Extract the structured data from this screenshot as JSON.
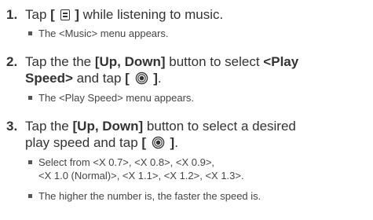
{
  "steps": [
    {
      "number": "1.",
      "pre": "Tap ",
      "bracket_open": "[ ",
      "icon": "menu-icon",
      "bracket_close": " ]",
      "post": " while listening to music.",
      "notes": [
        "The <Music> menu appears."
      ]
    },
    {
      "number": "2.",
      "line1_pre": "Tap the the ",
      "line1_bold": "[Up, Down]",
      "line1_mid": " button to select ",
      "line1_bold2": "<Play",
      "line2_bold": "Speed>",
      "line2_mid": " and tap ",
      "bracket_open": "[ ",
      "icon": "select-icon",
      "bracket_close": " ]",
      "line2_end": ".",
      "notes": [
        "The <Play Speed> menu appears."
      ]
    },
    {
      "number": "3.",
      "line1_pre": "Tap the ",
      "line1_bold": "[Up, Down]",
      "line1_post": " button to select a desired",
      "line2_pre": "play speed and tap ",
      "bracket_open": "[ ",
      "icon": "select-icon",
      "bracket_close": " ]",
      "line2_end": ".",
      "notes": [
        {
          "line1": "Select from <X 0.7>, <X 0.8>, <X 0.9>,",
          "line2": "<X 1.0 (Normal)>, <X 1.1>, <X 1.2>, <X 1.3>."
        },
        "The higher the number is, the faster the speed is."
      ]
    }
  ]
}
